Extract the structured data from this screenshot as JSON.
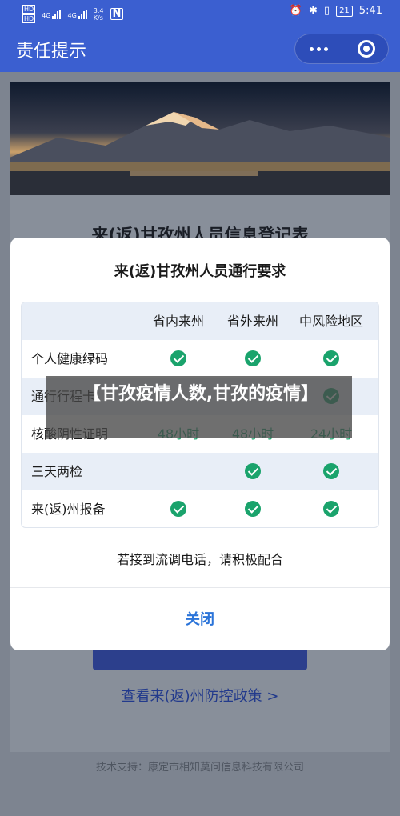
{
  "status_bar": {
    "network_left": "HD",
    "network_left2": "HD",
    "signal1": "4G",
    "signal2": "4G",
    "speed": "3.4",
    "speed_unit": "K/s",
    "nfc": "N",
    "battery": "21",
    "time": "5:41"
  },
  "header": {
    "title": "责任提示"
  },
  "page": {
    "form_title": "来(返)甘孜州人员信息登记表",
    "policy_link": "查看来(返)州防控政策 >",
    "tech_support": "技术支持：康定市相知莫问信息科技有限公司"
  },
  "modal": {
    "title": "来(返)甘孜州人员通行要求",
    "columns": [
      "省内来州",
      "省外来州",
      "中风险地区"
    ],
    "rows": [
      {
        "label": "个人健康绿码",
        "values": [
          "check",
          "check",
          "check"
        ]
      },
      {
        "label": "通行行程卡",
        "values": [
          "",
          "",
          "check"
        ]
      },
      {
        "label": "核酸阴性证明",
        "values": [
          "48小时",
          "48小时",
          "24小时"
        ]
      },
      {
        "label": "三天两检",
        "values": [
          "",
          "check",
          "check"
        ]
      },
      {
        "label": "来(返)州报备",
        "values": [
          "check",
          "check",
          "check"
        ]
      }
    ],
    "notice": "若接到流调电话，请积极配合",
    "close_label": "关闭"
  },
  "overlay": {
    "text": "【甘孜疫情人数,甘孜的疫情】"
  },
  "colors": {
    "brand_blue": "#3b5fd0",
    "check_green": "#1aa36c",
    "link_blue": "#2b74d9"
  }
}
